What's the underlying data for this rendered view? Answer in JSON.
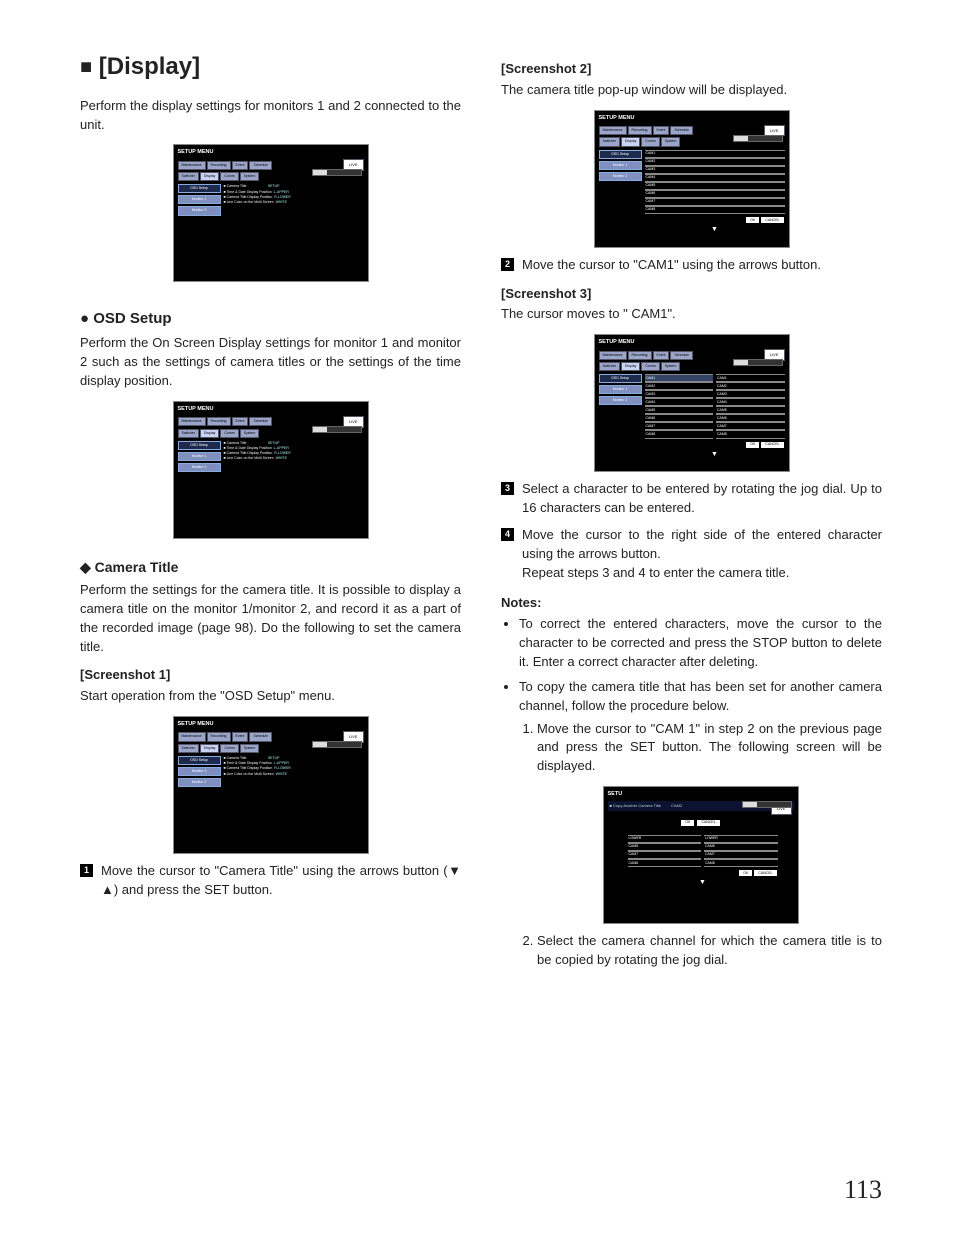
{
  "title_prefix": "■",
  "title": "[Display]",
  "intro": "Perform the display settings for monitors 1 and 2 connected to the unit.",
  "osd": {
    "heading": "● OSD Setup",
    "text": "Perform the On Screen Display settings for monitor 1 and monitor 2 such as the settings of camera titles or the settings of the time display position."
  },
  "camtitle": {
    "heading": "◆ Camera Title",
    "text": "Perform the settings for the camera title. It is possible to display a camera title on the monitor 1/monitor 2, and record it as a part of the recorded image (page 98). Do the following to set the camera title."
  },
  "sc1": {
    "label": "[Screenshot 1]",
    "text": "Start operation from the \"OSD Setup\" menu."
  },
  "step1": "Move the cursor to \"Camera Title\" using the arrows button (▼ ▲) and press the SET button.",
  "sc2": {
    "label": "[Screenshot 2]",
    "text": "The camera title pop-up window will be displayed."
  },
  "step2": "Move the cursor to \"CAM1\" using the arrows button.",
  "sc3": {
    "label": "[Screenshot 3]",
    "text": "The cursor moves to \" CAM1\"."
  },
  "step3": "Select a character to be entered by rotating the jog dial. Up to 16 characters can be entered.",
  "step4a": "Move the cursor to the right side of the entered character using the arrows button.",
  "step4b": "Repeat steps 3 and 4 to enter the camera title.",
  "notes_h": "Notes:",
  "note1": "To correct the entered characters, move the cursor to the character to be corrected and press the STOP button to delete it. Enter a correct character after deleting.",
  "note2": "To copy the camera title that has been set for another camera channel, follow the procedure below.",
  "note2s1": "Move the cursor to \"CAM 1\" in step 2 on the previous page and press the SET button. The following screen will be displayed.",
  "note2s2": "Select the camera channel for which the camera title is to be copied by rotating the jog dial.",
  "pagenum": "113",
  "shot_common": {
    "menu": "SETUP MENU",
    "tabs_r1": [
      "Maintenance",
      "Recording",
      "Event",
      "Schedule"
    ],
    "tabs_r2": [
      "Switcher",
      "Display",
      "Comm",
      "System"
    ],
    "live": "LIVE",
    "side": [
      "OSD Setup",
      "Monitor 1",
      "Monitor 2"
    ],
    "content": [
      "■ Camera Title",
      "■ Time & Date Display Position",
      "■ Camera Title Display Position",
      "■ Line Color on the Multi Screen"
    ],
    "vals": [
      "SETUP",
      "L-UPPER",
      "R-LOWER",
      "WHITE"
    ],
    "ok": "OK",
    "cancel": "CANCEL"
  },
  "cam_list_1col": [
    "CAM1",
    "CAM2",
    "CAM3",
    "CAM4",
    "CAM5",
    "CAM6",
    "CAM7",
    "CAM8"
  ],
  "cam_list_2col_a": [
    "CAM1",
    "CAM2",
    "CAM3",
    "CAM4",
    "CAM5",
    "CAM6",
    "CAM7",
    "CAM8"
  ],
  "cam_list_2col_b": [
    "CAM1",
    "CAM2",
    "CAM3",
    "CAM4",
    "CAM5",
    "CAM6",
    "CAM7",
    "CAM8"
  ],
  "copy_title": "■ Copy Another Camera Title",
  "copy_cur": "CAM2",
  "copy_list_a": [
    "LOWER",
    "CAM6",
    "CAM7",
    "CAM8"
  ],
  "copy_list_b": [
    "LOWER",
    "CAM6",
    "CAM7",
    "CAM8"
  ]
}
